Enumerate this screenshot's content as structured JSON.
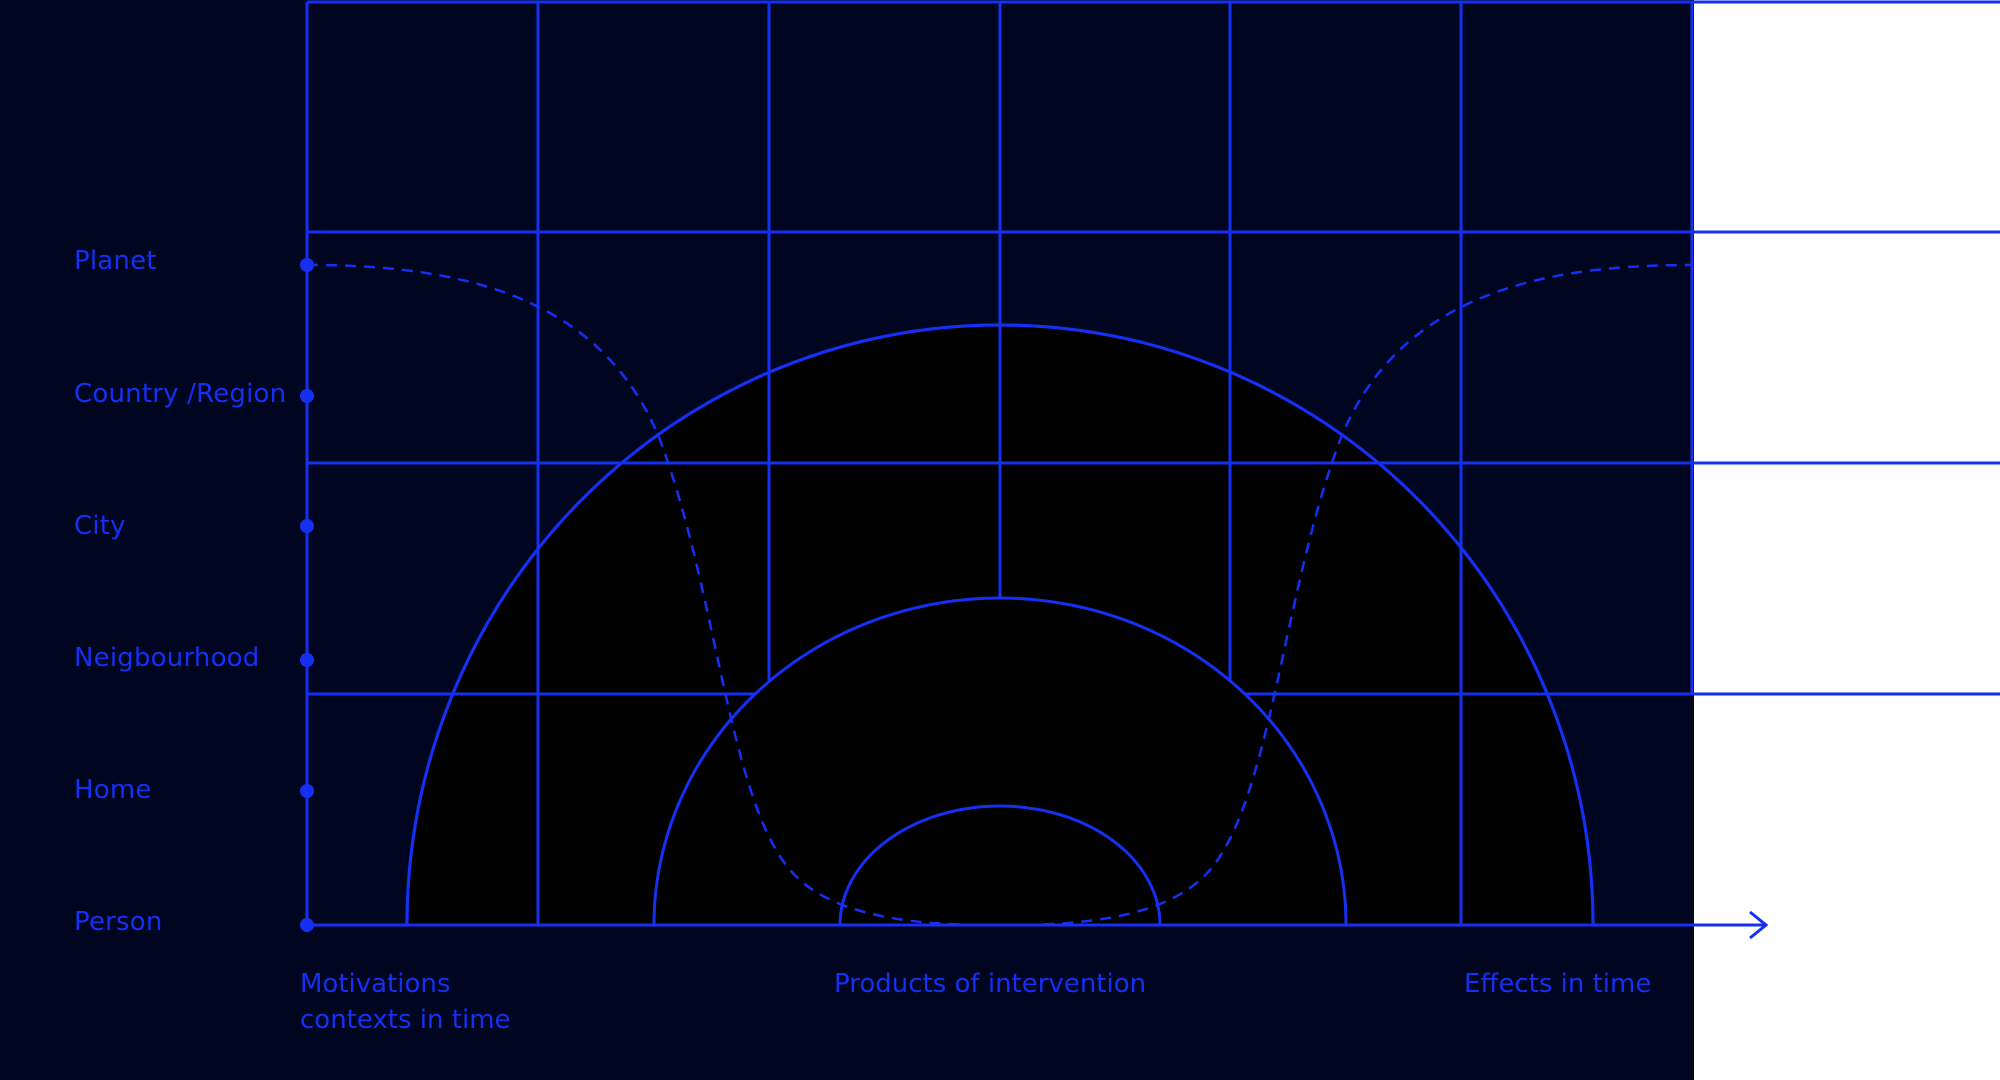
{
  "colors": {
    "background_dark": "#000520",
    "background_light": "#ffffff",
    "line": "#1530f2",
    "arc_fill": "#000000"
  },
  "scale_levels": [
    "Planet",
    "Country /Region",
    "City",
    "Neigbourhood",
    "Home",
    "Person"
  ],
  "captions": {
    "left": [
      "Motivations",
      "contexts in time"
    ],
    "center": "Products of intervention",
    "right": "Effects in time"
  },
  "icons": {
    "axis_arrow": "arrow-right-icon",
    "level_marker": "dot-marker"
  }
}
